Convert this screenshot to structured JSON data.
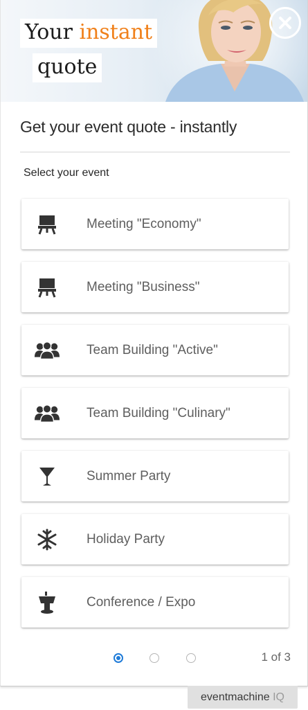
{
  "banner": {
    "title_word1": "Your",
    "title_word2": "instant",
    "title_word3": "quote",
    "accent_color": "#f0801a"
  },
  "header": {
    "title": "Get your event quote - instantly",
    "subtitle": "Select your event"
  },
  "options": [
    {
      "label": "Meeting \"Economy\"",
      "icon": "presentation-board-icon"
    },
    {
      "label": "Meeting \"Business\"",
      "icon": "presentation-board-icon"
    },
    {
      "label": "Team Building \"Active\"",
      "icon": "group-icon"
    },
    {
      "label": "Team Building \"Culinary\"",
      "icon": "group-icon"
    },
    {
      "label": "Summer Party",
      "icon": "cocktail-glass-icon"
    },
    {
      "label": "Holiday Party",
      "icon": "snowflake-icon"
    },
    {
      "label": "Conference / Expo",
      "icon": "podium-icon"
    }
  ],
  "pager": {
    "current_page": 1,
    "total_pages": 3,
    "label": "1 of 3",
    "active_color": "#1f7bd8"
  },
  "branding": {
    "name": "eventmachine",
    "suffix": "IQ"
  }
}
